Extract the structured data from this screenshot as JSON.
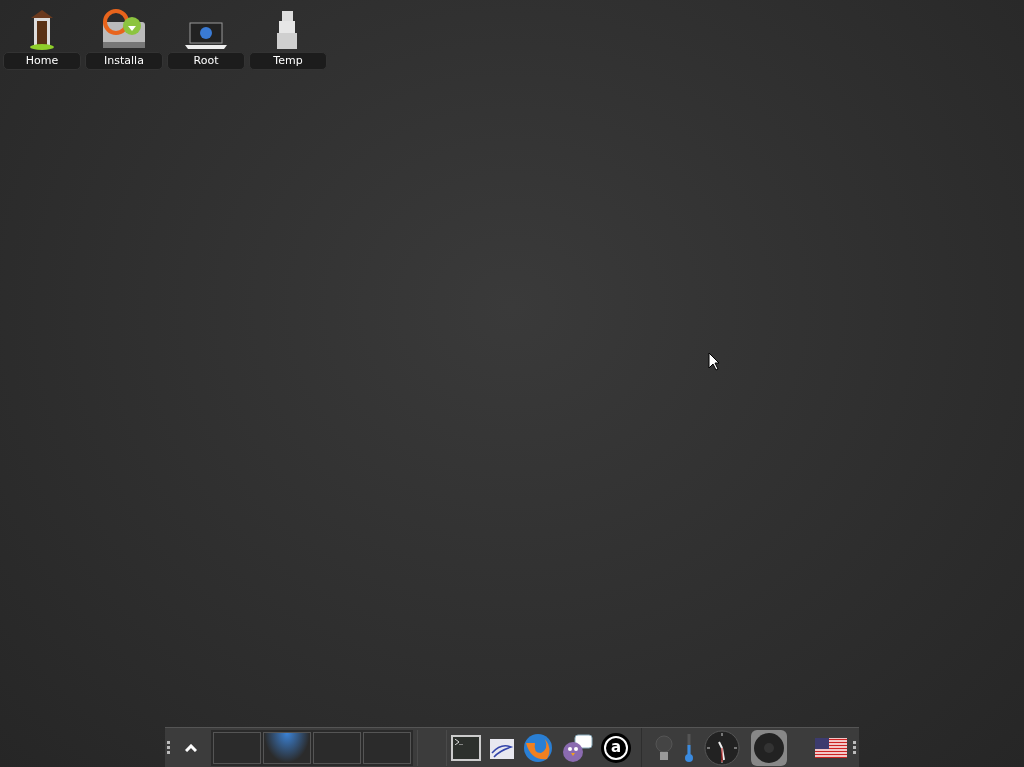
{
  "desktop_icons": [
    {
      "label": "Home",
      "kind": "door"
    },
    {
      "label": "Installa",
      "kind": "installer"
    },
    {
      "label": "Root",
      "kind": "laptop"
    },
    {
      "label": "Temp",
      "kind": "boxes"
    }
  ],
  "shelf": {
    "pager": [
      {
        "selected": false
      },
      {
        "selected": true
      },
      {
        "selected": false
      },
      {
        "selected": false
      }
    ],
    "launchers": [
      {
        "kind": "terminal"
      },
      {
        "kind": "document"
      },
      {
        "kind": "browser"
      },
      {
        "kind": "chat"
      },
      {
        "kind": "letter",
        "glyph": "a"
      }
    ],
    "gadgets": [
      {
        "kind": "bulb"
      },
      {
        "kind": "thermometer"
      },
      {
        "kind": "clock"
      },
      {
        "kind": "speaker"
      }
    ]
  }
}
